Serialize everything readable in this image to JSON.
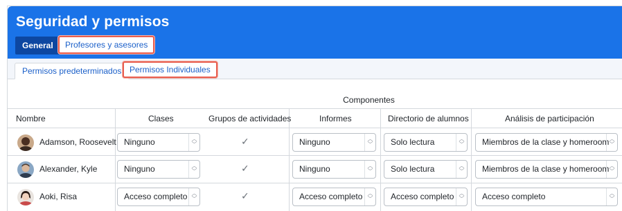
{
  "header": {
    "title": "Seguridad y permisos",
    "tabs": [
      "General",
      "Profesores y asesores"
    ]
  },
  "subtabs": [
    "Permisos predeterminados",
    "Permisos Individuales"
  ],
  "table": {
    "group_header": "Componentes",
    "columns": [
      "Nombre",
      "Clases",
      "Grupos de actividades",
      "Informes",
      "Directorio de alumnos",
      "Análisis de participación"
    ],
    "rows": [
      {
        "name": "Adamson, Roosevelt",
        "clases": "Ninguno",
        "grupos_check": "✓",
        "informes": "Ninguno",
        "directorio": "Solo lectura",
        "analisis": "Miembros de la clase y homeroom"
      },
      {
        "name": "Alexander, Kyle",
        "clases": "Ninguno",
        "grupos_check": "✓",
        "informes": "Ninguno",
        "directorio": "Solo lectura",
        "analisis": "Miembros de la clase y homeroom"
      },
      {
        "name": "Aoki, Risa",
        "clases": "Acceso completo",
        "grupos_check": "✓",
        "informes": "Acceso completo",
        "directorio": "Acceso completo",
        "analisis": "Acceso completo"
      }
    ]
  },
  "icons": {
    "select_arrows": "updown-chevron-icon",
    "check": "check-icon",
    "avatar": "user-photo"
  },
  "colors": {
    "brand": "#1a73e8",
    "active_tab": "#0d47a1",
    "highlight": "#e85d4e",
    "link": "#1a5fc9"
  }
}
